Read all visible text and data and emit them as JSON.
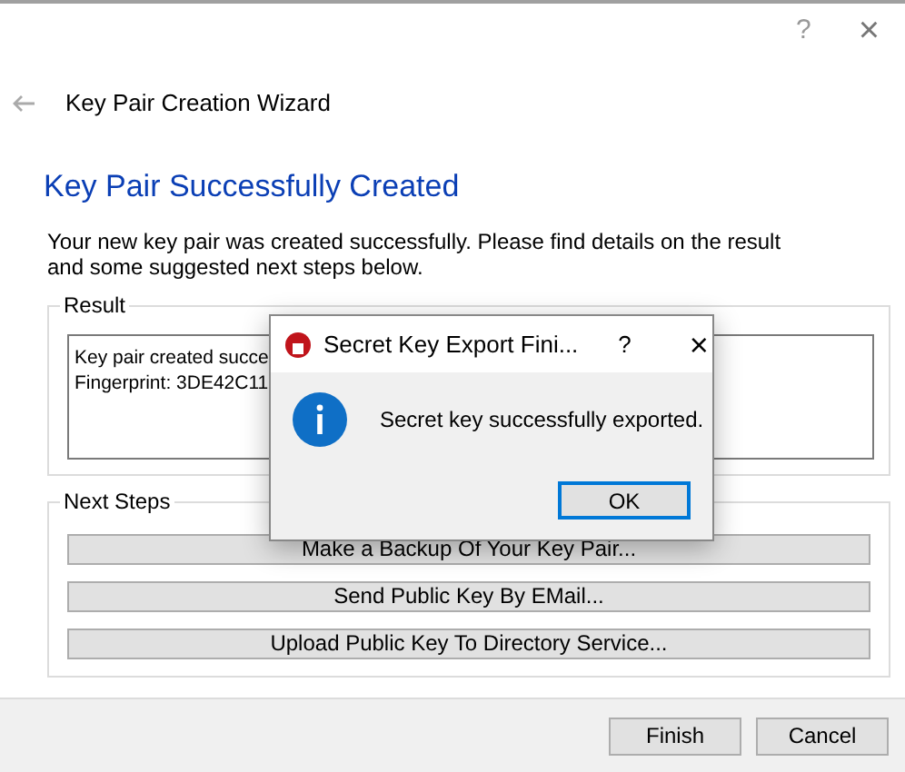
{
  "window": {
    "help": "?",
    "close": "×"
  },
  "wizard": {
    "title": "Key Pair Creation Wizard",
    "heading": "Key Pair Successfully Created",
    "description": "Your new key pair was created successfully. Please find details on the result and some suggested next steps below."
  },
  "result": {
    "label": "Result",
    "lines": [
      "Key pair created succe",
      "Fingerprint: 3DE42C11"
    ]
  },
  "next_steps": {
    "label": "Next Steps",
    "buttons": [
      "Make a Backup Of Your Key Pair...",
      "Send Public Key By EMail...",
      "Upload Public Key To Directory Service..."
    ]
  },
  "footer_buttons": [
    "Finish",
    "Cancel"
  ],
  "dialog": {
    "title": "Secret Key Export Fini...",
    "help": "?",
    "close": "×",
    "message": "Secret key successfully exported.",
    "button": "OK"
  }
}
